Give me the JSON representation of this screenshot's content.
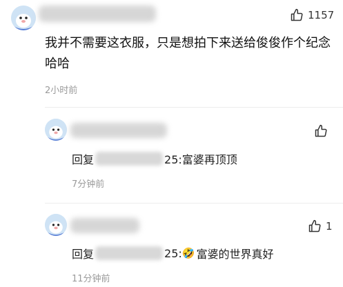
{
  "comment": {
    "author": "",
    "likes": "1157",
    "text": "我并不需要这衣服，只是想拍下来送给俊俊作个纪念哈哈",
    "time": "2小时前"
  },
  "replies": [
    {
      "author": "",
      "likes": "",
      "prefix": "回复",
      "suffix": "25:富婆再顶顶",
      "emoji": "",
      "time": "7分钟前"
    },
    {
      "author": "",
      "likes": "1",
      "prefix": "回复",
      "suffix": "25:",
      "emoji": "🤣",
      "rest": "富婆的世界真好",
      "time": "11分钟前"
    }
  ],
  "icons": {
    "like": "thumbs-up-icon",
    "avatar": "avatar-seal-icon"
  }
}
